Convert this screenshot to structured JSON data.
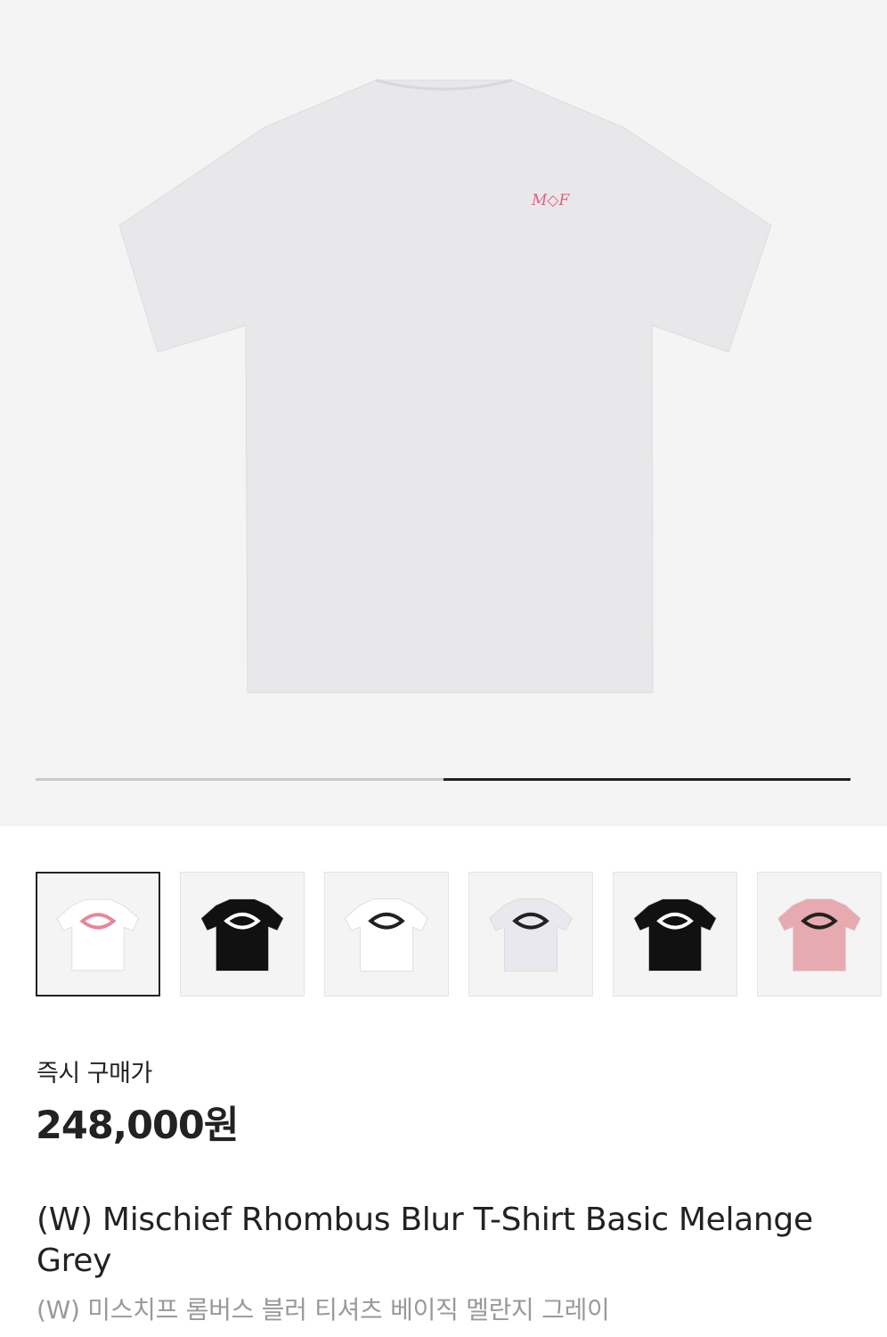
{
  "product": {
    "hero_image": {
      "icon": "tshirt-back-image",
      "logo_text": "M◇F",
      "shirt_color": "#e8e8ea",
      "logo_color": "#e0607a"
    },
    "gallery_progress": 0.5,
    "thumbnails": [
      {
        "icon": "tshirt-thumbnail",
        "shirt": "#ffffff",
        "mark": "#e58797",
        "selected": true
      },
      {
        "icon": "tshirt-thumbnail",
        "shirt": "#111111",
        "mark": "#ffffff",
        "selected": false
      },
      {
        "icon": "tshirt-thumbnail",
        "shirt": "#ffffff",
        "mark": "#222222",
        "selected": false
      },
      {
        "icon": "tshirt-thumbnail",
        "shirt": "#e9e8ee",
        "mark": "#222222",
        "selected": false
      },
      {
        "icon": "tshirt-thumbnail",
        "shirt": "#111111",
        "mark": "#ffffff",
        "selected": false
      },
      {
        "icon": "tshirt-thumbnail",
        "shirt": "#e7aab0",
        "mark": "#222222",
        "selected": false
      }
    ],
    "price_label": "즉시 구매가",
    "price": "248,000원",
    "title_en": "(W) Mischief Rhombus Blur T-Shirt Basic Melange Grey",
    "title_ko": "(W) 미스치프 롬버스 블러 티셔츠 베이직 멜란지 그레이"
  }
}
